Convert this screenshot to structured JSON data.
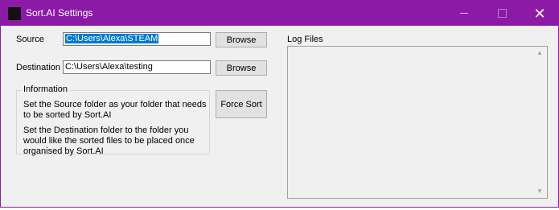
{
  "window": {
    "title": "Sort.AI Settings",
    "close_glyph": "✕"
  },
  "source": {
    "label": "Source",
    "value": "C:\\Users\\Alexa\\STEAM",
    "browse_label": "Browse"
  },
  "destination": {
    "label": "Destination",
    "value": "C:\\Users\\Alexa\\testing",
    "browse_label": "Browse"
  },
  "information": {
    "title": "Information",
    "line1": "Set the Source folder as your folder that needs to be sorted by Sort.AI",
    "line2": "Set the Destination folder to the folder you would like the sorted files to be placed once organised by Sort.AI"
  },
  "force_sort_label": "Force Sort",
  "log": {
    "label": "Log Files",
    "scroll_up_glyph": "▲",
    "scroll_down_glyph": "▼"
  },
  "colors": {
    "titlebar": "#8c1aa6",
    "selection": "#0078d7"
  }
}
